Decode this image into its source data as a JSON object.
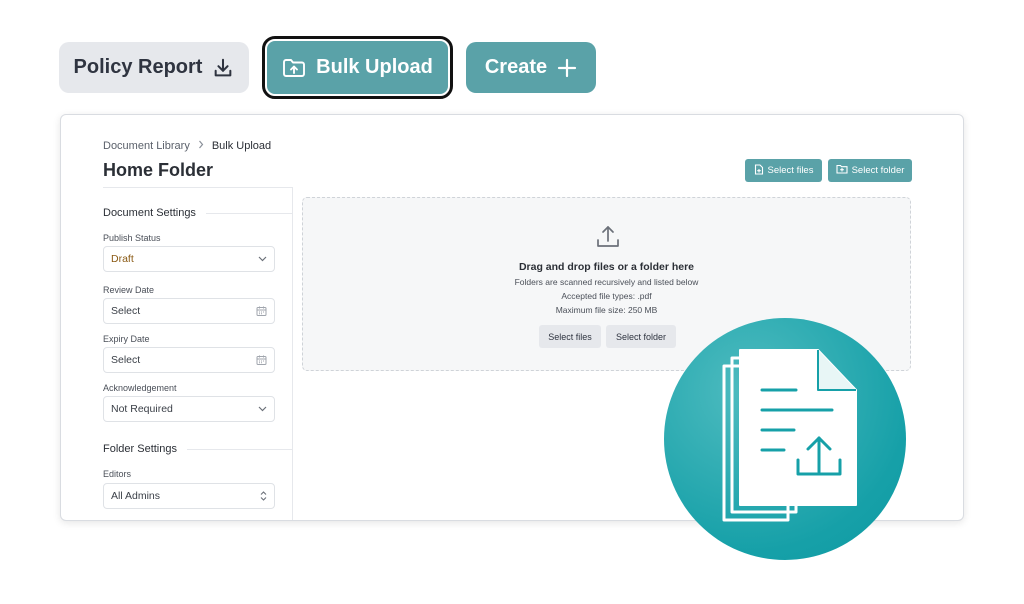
{
  "toolbar": {
    "policy_report_label": "Policy Report",
    "bulk_upload_label": "Bulk Upload",
    "create_label": "Create"
  },
  "breadcrumb": {
    "root": "Document Library",
    "current": "Bulk Upload"
  },
  "page_title": "Home Folder",
  "header_actions": {
    "select_files": "Select files",
    "select_folder": "Select folder"
  },
  "document_settings": {
    "heading": "Document Settings",
    "publish_status": {
      "label": "Publish Status",
      "value": "Draft"
    },
    "review_date": {
      "label": "Review Date",
      "value": "Select"
    },
    "expiry_date": {
      "label": "Expiry Date",
      "value": "Select"
    },
    "acknowledgement": {
      "label": "Acknowledgement",
      "value": "Not Required"
    }
  },
  "folder_settings": {
    "heading": "Folder Settings",
    "editors": {
      "label": "Editors",
      "value": "All Admins"
    }
  },
  "dropzone": {
    "title": "Drag and drop files or a folder here",
    "line1": "Folders are scanned recursively and listed below",
    "line2": "Accepted file types: .pdf",
    "line3": "Maximum file size: 250 MB",
    "select_files": "Select files",
    "select_folder": "Select folder"
  },
  "colors": {
    "accent": "#5aa2a8",
    "badge": "#16a0a8",
    "draft_text": "#8a5a14"
  },
  "icons": [
    "download-icon",
    "folder-upload-icon",
    "plus-icon",
    "file-add-icon",
    "folder-add-icon",
    "chevron-down-icon",
    "calendar-icon",
    "chevron-updown-icon",
    "upload-icon",
    "document-upload-icon"
  ]
}
